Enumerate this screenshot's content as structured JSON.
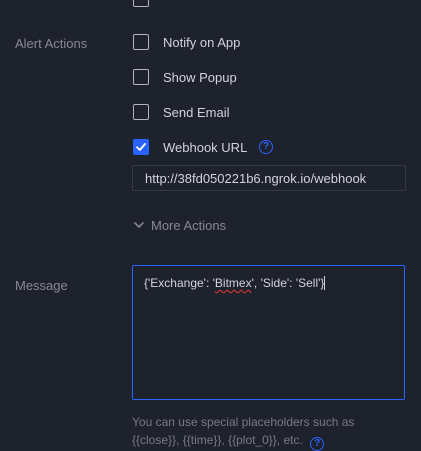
{
  "alert_actions": {
    "label": "Alert Actions",
    "options": [
      {
        "label": "Notify on App",
        "checked": false
      },
      {
        "label": "Show Popup",
        "checked": false
      },
      {
        "label": "Send Email",
        "checked": false
      },
      {
        "label": "Webhook URL",
        "checked": true
      }
    ],
    "webhook_url_value": "http://38fd050221b6.ngrok.io/webhook",
    "more_actions_label": "More Actions"
  },
  "message": {
    "label": "Message",
    "prefix": "{'Exchange': '",
    "misspelled_word": "Bitmex",
    "suffix": "', 'Side': 'Sell'}"
  },
  "hint": {
    "line1": "You can use special placeholders such as",
    "line2": "{{close}}, {{time}}, {{plot_0}}, etc."
  },
  "colors": {
    "accent": "#2962ff",
    "background": "#1e222d",
    "border": "#363a45",
    "muted_text": "#868993",
    "text": "#d1d4dc"
  },
  "icons": {
    "checkmark": "checkmark-icon",
    "help": "question-circle-icon",
    "chevron": "chevron-down-icon"
  }
}
